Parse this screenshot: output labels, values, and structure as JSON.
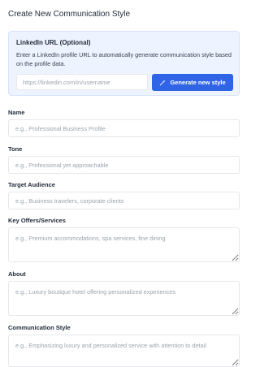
{
  "page": {
    "title": "Create New Communication Style"
  },
  "linkedin": {
    "title": "LinkedIn URL (Optional)",
    "description": "Enter a LinkedIn profile URL to automatically generate communication style based on the profile data.",
    "placeholder": "https://linkedin.com/in/username",
    "button_label": "Generate new style",
    "button_icon": "wand-icon",
    "accent": "#2f64e6",
    "card_bg": "#eef4ff"
  },
  "form": {
    "name": {
      "label": "Name",
      "placeholder": "e.g., Professional Business Profile"
    },
    "tone": {
      "label": "Tone",
      "placeholder": "e.g., Professional yet approachable"
    },
    "audience": {
      "label": "Target Audience",
      "placeholder": "e.g., Business travelers, corporate clients"
    },
    "offers": {
      "label": "Key Offers/Services",
      "placeholder": "e.g., Premium accommodations, spa services, fine dining"
    },
    "about": {
      "label": "About",
      "placeholder": "e.g., Luxury boutique hotel offering personalized experiences"
    },
    "style": {
      "label": "Communication Style",
      "placeholder": "e.g., Emphasizing luxury and personalized service with attention to detail"
    }
  }
}
